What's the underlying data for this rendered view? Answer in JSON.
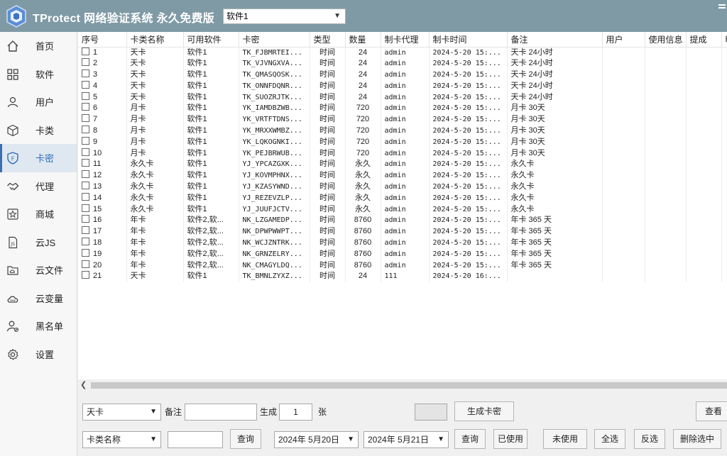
{
  "titlebar": {
    "app_title": "TProtect 网络验证系统 永久免费版",
    "software_select": "软件1"
  },
  "sidebar": {
    "items": [
      {
        "label": "首页",
        "icon": "home-icon"
      },
      {
        "label": "软件",
        "icon": "grid-icon"
      },
      {
        "label": "用户",
        "icon": "user-icon"
      },
      {
        "label": "卡类",
        "icon": "box-icon"
      },
      {
        "label": "卡密",
        "icon": "shield-key-icon"
      },
      {
        "label": "代理",
        "icon": "handshake-icon"
      },
      {
        "label": "商城",
        "icon": "star-shop-icon"
      },
      {
        "label": "云JS",
        "icon": "js-file-icon"
      },
      {
        "label": "云文件",
        "icon": "cloud-folder-icon"
      },
      {
        "label": "云变量",
        "icon": "cloud-icon"
      },
      {
        "label": "黑名单",
        "icon": "block-user-icon"
      },
      {
        "label": "设置",
        "icon": "gear-icon"
      }
    ]
  },
  "table": {
    "headers": [
      "序号",
      "卡类名称",
      "可用软件",
      "卡密",
      "类型",
      "数量",
      "制卡代理",
      "制卡时间",
      "备注",
      "用户",
      "使用信息",
      "提成",
      "Ю"
    ],
    "rows": [
      [
        "1",
        "天卡",
        "软件1",
        "TK_FJBMRTEI...",
        "时间",
        "24",
        "admin",
        "2024-5-20 15:...",
        "天卡 24小时"
      ],
      [
        "2",
        "天卡",
        "软件1",
        "TK_VJVNGXVA...",
        "时间",
        "24",
        "admin",
        "2024-5-20 15:...",
        "天卡 24小时"
      ],
      [
        "3",
        "天卡",
        "软件1",
        "TK_QMASQOSK...",
        "时间",
        "24",
        "admin",
        "2024-5-20 15:...",
        "天卡 24小时"
      ],
      [
        "4",
        "天卡",
        "软件1",
        "TK_ONNFDQNR...",
        "时间",
        "24",
        "admin",
        "2024-5-20 15:...",
        "天卡 24小时"
      ],
      [
        "5",
        "天卡",
        "软件1",
        "TK_SUOZRJTK...",
        "时间",
        "24",
        "admin",
        "2024-5-20 15:...",
        "天卡 24小时"
      ],
      [
        "6",
        "月卡",
        "软件1",
        "YK_IAMDBZWB...",
        "时间",
        "720",
        "admin",
        "2024-5-20 15:...",
        "月卡 30天"
      ],
      [
        "7",
        "月卡",
        "软件1",
        "YK_VRTFTDNS...",
        "时间",
        "720",
        "admin",
        "2024-5-20 15:...",
        "月卡 30天"
      ],
      [
        "8",
        "月卡",
        "软件1",
        "YK_MRXXWMBZ...",
        "时间",
        "720",
        "admin",
        "2024-5-20 15:...",
        "月卡 30天"
      ],
      [
        "9",
        "月卡",
        "软件1",
        "YK_LQKOGNKI...",
        "时间",
        "720",
        "admin",
        "2024-5-20 15:...",
        "月卡 30天"
      ],
      [
        "10",
        "月卡",
        "软件1",
        "YK_PEJBRWUB...",
        "时间",
        "720",
        "admin",
        "2024-5-20 15:...",
        "月卡 30天"
      ],
      [
        "11",
        "永久卡",
        "软件1",
        "YJ_YPCAZGXK...",
        "时间",
        "永久",
        "admin",
        "2024-5-20 15:...",
        "永久卡"
      ],
      [
        "12",
        "永久卡",
        "软件1",
        "YJ_KOVMPHNX...",
        "时间",
        "永久",
        "admin",
        "2024-5-20 15:...",
        "永久卡"
      ],
      [
        "13",
        "永久卡",
        "软件1",
        "YJ_KZASYWND...",
        "时间",
        "永久",
        "admin",
        "2024-5-20 15:...",
        "永久卡"
      ],
      [
        "14",
        "永久卡",
        "软件1",
        "YJ_REZEVZLP...",
        "时间",
        "永久",
        "admin",
        "2024-5-20 15:...",
        "永久卡"
      ],
      [
        "15",
        "永久卡",
        "软件1",
        "YJ_JUUFJCTV...",
        "时间",
        "永久",
        "admin",
        "2024-5-20 15:...",
        "永久卡"
      ],
      [
        "16",
        "年卡",
        "软件2,软...",
        "NK_LZGAMEDP...",
        "时间",
        "8760",
        "admin",
        "2024-5-20 15:...",
        "年卡 365 天"
      ],
      [
        "17",
        "年卡",
        "软件2,软...",
        "NK_DPWPWWPT...",
        "时间",
        "8760",
        "admin",
        "2024-5-20 15:...",
        "年卡 365 天"
      ],
      [
        "18",
        "年卡",
        "软件2,软...",
        "NK_WCJZNTRK...",
        "时间",
        "8760",
        "admin",
        "2024-5-20 15:...",
        "年卡 365 天"
      ],
      [
        "19",
        "年卡",
        "软件2,软...",
        "NK_GRNZELRY...",
        "时间",
        "8760",
        "admin",
        "2024-5-20 15:...",
        "年卡 365 天"
      ],
      [
        "20",
        "年卡",
        "软件2,软...",
        "NK_CMAGYLDQ...",
        "时间",
        "8760",
        "admin",
        "2024-5-20 15:...",
        "年卡 365 天"
      ],
      [
        "21",
        "天卡",
        "软件1",
        "TK_BMNLZYXZ...",
        "时间",
        "24",
        "111",
        "2024-5-20 16:...",
        ""
      ]
    ]
  },
  "bottom": {
    "card_type_select": "天卡",
    "remark_label": "备注",
    "remark_value": "",
    "generate_label": "生成",
    "generate_count": "1",
    "unit_label": "张",
    "generate_button": "生成卡密",
    "view_button": "查看",
    "search_field_select": "卡类名称",
    "search_value": "",
    "query_button": "查询",
    "date_from": "2024年  5月20日",
    "date_to": "2024年  5月21日",
    "query_date_button": "查询",
    "used_button": "已使用",
    "unused_button": "未使用",
    "select_all_button": "全选",
    "invert_button": "反选",
    "delete_selected_button": "删除选中"
  }
}
